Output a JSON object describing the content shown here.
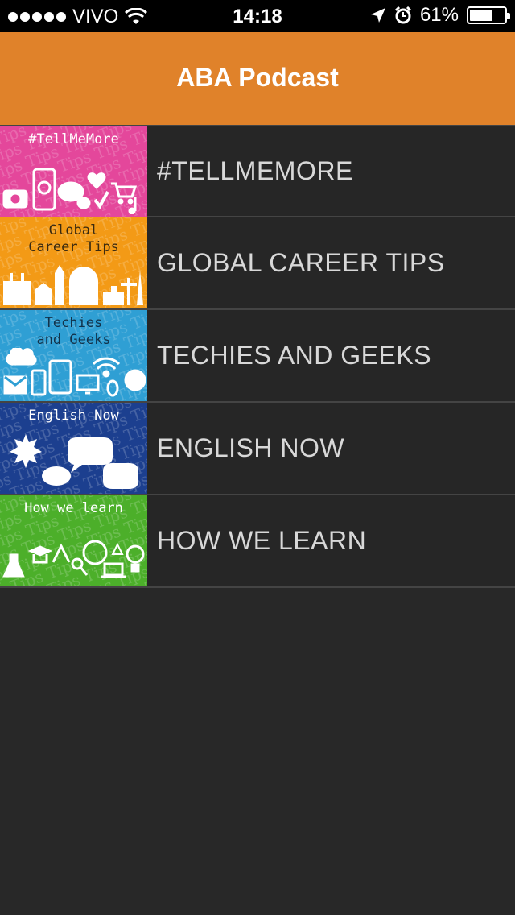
{
  "status": {
    "carrier": "VIVO",
    "time": "14:18",
    "battery_text": "61%",
    "battery_level": 0.61
  },
  "nav": {
    "title": "ABA Podcast"
  },
  "items": [
    {
      "label": "#TELLMEMORE",
      "thumb_title": "#TellMeMore",
      "color": "#e4479b",
      "title_color": "#ffffff"
    },
    {
      "label": "GLOBAL CAREER TIPS",
      "thumb_title_1": "Global",
      "thumb_title_2": "Career Tips",
      "color": "#f39a16",
      "title_color": "#3a2a10"
    },
    {
      "label": "TECHIES AND GEEKS",
      "thumb_title_1": "Techies",
      "thumb_title_2": "and Geeks",
      "color": "#2f9fd4",
      "title_color": "#12324a"
    },
    {
      "label": "ENGLISH NOW",
      "thumb_title": "English Now",
      "color": "#1c3f8f",
      "title_color": "#ffffff"
    },
    {
      "label": "HOW WE LEARN",
      "thumb_title": "How we learn",
      "color": "#4caf2a",
      "title_color": "#ffffff"
    }
  ],
  "thumb_pattern_word": "Tips"
}
